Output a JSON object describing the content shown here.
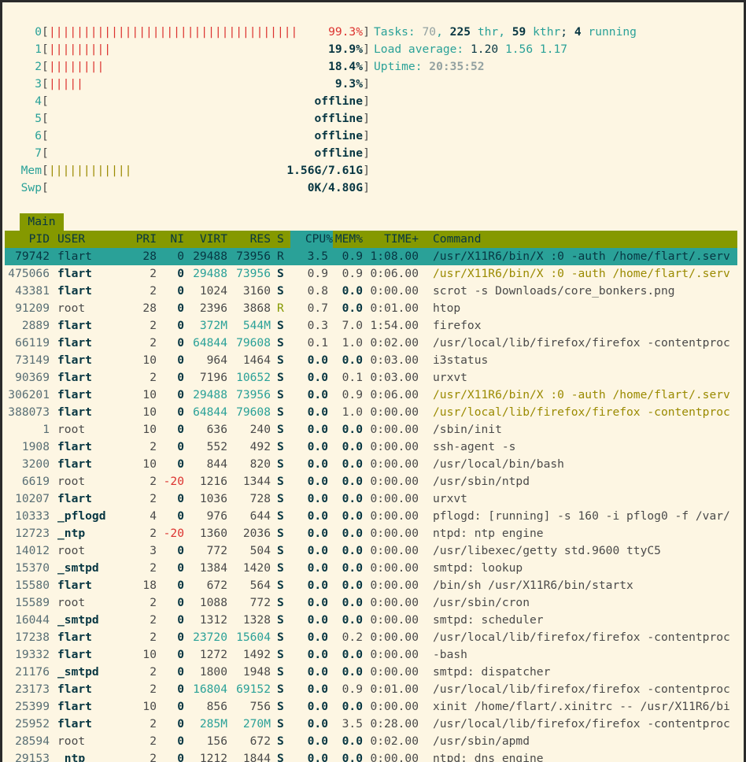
{
  "meters": {
    "cpus": [
      {
        "id": "0",
        "bar": "||||||||||||||||||||||||||||||||||||",
        "value": "99.3%",
        "fill": 0.993
      },
      {
        "id": "1",
        "bar": "|||||||||",
        "value": "19.9%",
        "fill": 0.199
      },
      {
        "id": "2",
        "bar": "||||||||",
        "value": "18.4%",
        "fill": 0.184
      },
      {
        "id": "3",
        "bar": "|||||",
        "value": "9.3%",
        "fill": 0.093
      },
      {
        "id": "4",
        "bar": "",
        "value": "offline",
        "fill": 0
      },
      {
        "id": "5",
        "bar": "",
        "value": "offline",
        "fill": 0
      },
      {
        "id": "6",
        "bar": "",
        "value": "offline",
        "fill": 0
      },
      {
        "id": "7",
        "bar": "",
        "value": "offline",
        "fill": 0
      }
    ],
    "mem": {
      "label": "Mem",
      "bar": "||||||||||||",
      "value": "1.56G/7.61G",
      "fill": 0.205
    },
    "swp": {
      "label": "Swp",
      "bar": "",
      "value": "0K/4.80G",
      "fill": 0
    }
  },
  "summary": {
    "tasks_label": "Tasks: ",
    "tasks": "70",
    "tasks_sep": ", ",
    "thr": "225",
    "thr_label": " thr",
    "kthr_sep": ", ",
    "kthr": "59",
    "kthr_label": " kthr",
    "running_sep": "; ",
    "running": "4",
    "running_label": " running",
    "load_label": "Load average: ",
    "load1": "1.20",
    "load5": "1.56",
    "load15": "1.17",
    "uptime_label": "Uptime: ",
    "uptime": "20:35:52"
  },
  "tabs": {
    "main": "Main"
  },
  "columns": {
    "pid": "PID",
    "user": "USER",
    "pri": "PRI",
    "ni": "NI",
    "virt": "VIRT",
    "res": "RES",
    "s": "S",
    "cpu": "CPU%",
    "mem": "MEM%",
    "time": "TIME+",
    "command": "Command"
  },
  "processes": [
    {
      "pid": "79742",
      "user": "flart",
      "pri": "28",
      "ni": "0",
      "virt": "29488",
      "res": "73956",
      "s": "R",
      "cpu": "3.5",
      "mem": "0.9",
      "time": "1:08.00",
      "command": "/usr/X11R6/bin/X :0 -auth /home/flart/.serv"
    },
    {
      "pid": "475066",
      "user": "flart",
      "pri": "2",
      "ni": "0",
      "virt": "29488",
      "res": "73956",
      "s": "S",
      "cpu": "0.9",
      "mem": "0.9",
      "time": "0:06.00",
      "command": "/usr/X11R6/bin/X :0 -auth /home/flart/.serv"
    },
    {
      "pid": "43381",
      "user": "flart",
      "pri": "2",
      "ni": "0",
      "virt": "1024",
      "res": "3160",
      "s": "S",
      "cpu": "0.8",
      "mem": "0.0",
      "time": "0:00.00",
      "command": "scrot -s Downloads/core_bonkers.png"
    },
    {
      "pid": "91209",
      "user": "root",
      "pri": "28",
      "ni": "0",
      "virt": "2396",
      "res": "3868",
      "s": "R",
      "cpu": "0.7",
      "mem": "0.0",
      "time": "0:01.00",
      "command": "htop"
    },
    {
      "pid": "2889",
      "user": "flart",
      "pri": "2",
      "ni": "0",
      "virt": "372M",
      "res": "544M",
      "s": "S",
      "cpu": "0.3",
      "mem": "7.0",
      "time": "1:54.00",
      "command": "firefox"
    },
    {
      "pid": "66119",
      "user": "flart",
      "pri": "2",
      "ni": "0",
      "virt": "64844",
      "res": "79608",
      "s": "S",
      "cpu": "0.1",
      "mem": "1.0",
      "time": "0:02.00",
      "command": "/usr/local/lib/firefox/firefox -contentproc"
    },
    {
      "pid": "73149",
      "user": "flart",
      "pri": "10",
      "ni": "0",
      "virt": "964",
      "res": "1464",
      "s": "S",
      "cpu": "0.0",
      "mem": "0.0",
      "time": "0:03.00",
      "command": "i3status"
    },
    {
      "pid": "90369",
      "user": "flart",
      "pri": "2",
      "ni": "0",
      "virt": "7196",
      "res": "10652",
      "s": "S",
      "cpu": "0.0",
      "mem": "0.1",
      "time": "0:03.00",
      "command": "urxvt"
    },
    {
      "pid": "306201",
      "user": "flart",
      "pri": "10",
      "ni": "0",
      "virt": "29488",
      "res": "73956",
      "s": "S",
      "cpu": "0.0",
      "mem": "0.9",
      "time": "0:06.00",
      "command": "/usr/X11R6/bin/X :0 -auth /home/flart/.serv"
    },
    {
      "pid": "388073",
      "user": "flart",
      "pri": "10",
      "ni": "0",
      "virt": "64844",
      "res": "79608",
      "s": "S",
      "cpu": "0.0",
      "mem": "1.0",
      "time": "0:00.00",
      "command": "/usr/local/lib/firefox/firefox -contentproc"
    },
    {
      "pid": "1",
      "user": "root",
      "pri": "10",
      "ni": "0",
      "virt": "636",
      "res": "240",
      "s": "S",
      "cpu": "0.0",
      "mem": "0.0",
      "time": "0:00.00",
      "command": "/sbin/init"
    },
    {
      "pid": "1908",
      "user": "flart",
      "pri": "2",
      "ni": "0",
      "virt": "552",
      "res": "492",
      "s": "S",
      "cpu": "0.0",
      "mem": "0.0",
      "time": "0:00.00",
      "command": "ssh-agent -s"
    },
    {
      "pid": "3200",
      "user": "flart",
      "pri": "10",
      "ni": "0",
      "virt": "844",
      "res": "820",
      "s": "S",
      "cpu": "0.0",
      "mem": "0.0",
      "time": "0:00.00",
      "command": "/usr/local/bin/bash"
    },
    {
      "pid": "6619",
      "user": "root",
      "pri": "2",
      "ni": "-20",
      "virt": "1216",
      "res": "1344",
      "s": "S",
      "cpu": "0.0",
      "mem": "0.0",
      "time": "0:00.00",
      "command": "/usr/sbin/ntpd"
    },
    {
      "pid": "10207",
      "user": "flart",
      "pri": "2",
      "ni": "0",
      "virt": "1036",
      "res": "728",
      "s": "S",
      "cpu": "0.0",
      "mem": "0.0",
      "time": "0:00.00",
      "command": "urxvt"
    },
    {
      "pid": "10333",
      "user": "_pflogd",
      "pri": "4",
      "ni": "0",
      "virt": "976",
      "res": "644",
      "s": "S",
      "cpu": "0.0",
      "mem": "0.0",
      "time": "0:00.00",
      "command": "pflogd: [running] -s 160 -i pflog0 -f /var/"
    },
    {
      "pid": "12723",
      "user": "_ntp",
      "pri": "2",
      "ni": "-20",
      "virt": "1360",
      "res": "2036",
      "s": "S",
      "cpu": "0.0",
      "mem": "0.0",
      "time": "0:00.00",
      "command": "ntpd: ntp engine"
    },
    {
      "pid": "14012",
      "user": "root",
      "pri": "3",
      "ni": "0",
      "virt": "772",
      "res": "504",
      "s": "S",
      "cpu": "0.0",
      "mem": "0.0",
      "time": "0:00.00",
      "command": "/usr/libexec/getty std.9600 ttyC5"
    },
    {
      "pid": "15370",
      "user": "_smtpd",
      "pri": "2",
      "ni": "0",
      "virt": "1384",
      "res": "1420",
      "s": "S",
      "cpu": "0.0",
      "mem": "0.0",
      "time": "0:00.00",
      "command": "smtpd: lookup"
    },
    {
      "pid": "15580",
      "user": "flart",
      "pri": "18",
      "ni": "0",
      "virt": "672",
      "res": "564",
      "s": "S",
      "cpu": "0.0",
      "mem": "0.0",
      "time": "0:00.00",
      "command": "/bin/sh /usr/X11R6/bin/startx"
    },
    {
      "pid": "15589",
      "user": "root",
      "pri": "2",
      "ni": "0",
      "virt": "1088",
      "res": "772",
      "s": "S",
      "cpu": "0.0",
      "mem": "0.0",
      "time": "0:00.00",
      "command": "/usr/sbin/cron"
    },
    {
      "pid": "16044",
      "user": "_smtpd",
      "pri": "2",
      "ni": "0",
      "virt": "1312",
      "res": "1328",
      "s": "S",
      "cpu": "0.0",
      "mem": "0.0",
      "time": "0:00.00",
      "command": "smtpd: scheduler"
    },
    {
      "pid": "17238",
      "user": "flart",
      "pri": "2",
      "ni": "0",
      "virt": "23720",
      "res": "15604",
      "s": "S",
      "cpu": "0.0",
      "mem": "0.2",
      "time": "0:00.00",
      "command": "/usr/local/lib/firefox/firefox -contentproc"
    },
    {
      "pid": "19332",
      "user": "flart",
      "pri": "10",
      "ni": "0",
      "virt": "1272",
      "res": "1492",
      "s": "S",
      "cpu": "0.0",
      "mem": "0.0",
      "time": "0:00.00",
      "command": "-bash"
    },
    {
      "pid": "21176",
      "user": "_smtpd",
      "pri": "2",
      "ni": "0",
      "virt": "1800",
      "res": "1948",
      "s": "S",
      "cpu": "0.0",
      "mem": "0.0",
      "time": "0:00.00",
      "command": "smtpd: dispatcher"
    },
    {
      "pid": "23173",
      "user": "flart",
      "pri": "2",
      "ni": "0",
      "virt": "16804",
      "res": "69152",
      "s": "S",
      "cpu": "0.0",
      "mem": "0.9",
      "time": "0:01.00",
      "command": "/usr/local/lib/firefox/firefox -contentproc"
    },
    {
      "pid": "25399",
      "user": "flart",
      "pri": "10",
      "ni": "0",
      "virt": "856",
      "res": "756",
      "s": "S",
      "cpu": "0.0",
      "mem": "0.0",
      "time": "0:00.00",
      "command": "xinit /home/flart/.xinitrc -- /usr/X11R6/bi"
    },
    {
      "pid": "25952",
      "user": "flart",
      "pri": "2",
      "ni": "0",
      "virt": "285M",
      "res": "270M",
      "s": "S",
      "cpu": "0.0",
      "mem": "3.5",
      "time": "0:28.00",
      "command": "/usr/local/lib/firefox/firefox -contentproc"
    },
    {
      "pid": "28594",
      "user": "root",
      "pri": "2",
      "ni": "0",
      "virt": "156",
      "res": "672",
      "s": "S",
      "cpu": "0.0",
      "mem": "0.0",
      "time": "0:02.00",
      "command": "/usr/sbin/apmd"
    },
    {
      "pid": "29153",
      "user": "_ntp",
      "pri": "2",
      "ni": "0",
      "virt": "1212",
      "res": "1844",
      "s": "S",
      "cpu": "0.0",
      "mem": "0.0",
      "time": "0:00.00",
      "command": "ntpd: dns engine"
    }
  ],
  "colors": {
    "background": "#fdf6e3",
    "cyan": "#2aa198",
    "red": "#dc322f",
    "green": "#859900",
    "olive": "#9a8a00",
    "header_bg": "#859900",
    "selected_bg": "#2aa198"
  }
}
